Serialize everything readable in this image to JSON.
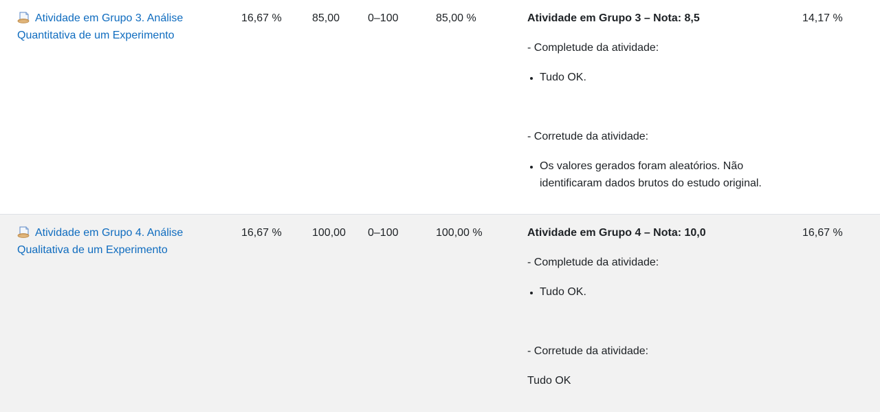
{
  "rows": [
    {
      "item_icon": "assignment-icon",
      "item_name": "Atividade em Grupo 3. Análise Quantitativa de um Experimento",
      "weight": "16,67 %",
      "grade": "85,00",
      "range": "0–100",
      "percentage": "85,00 %",
      "feedback": {
        "title": "Atividade em Grupo 3 – Nota: 8,5",
        "completeness_label": "- Completude da atividade:",
        "completeness_items": [
          "Tudo OK."
        ],
        "correctness_label": "- Corretude da atividade:",
        "correctness_items": [
          "Os valores gerados foram aleatórios. Não identificaram dados brutos do estudo original."
        ]
      },
      "contribution": "14,17 %"
    },
    {
      "item_icon": "assignment-icon",
      "item_name": "Atividade em Grupo 4. Análise Qualitativa de um Experimento",
      "weight": "16,67 %",
      "grade": "100,00",
      "range": "0–100",
      "percentage": "100,00 %",
      "feedback": {
        "title": "Atividade em Grupo 4 – Nota: 10,0",
        "completeness_label": "- Completude da atividade:",
        "completeness_items": [
          "Tudo OK."
        ],
        "correctness_label": "- Corretude da atividade:",
        "correctness_text": "Tudo OK"
      },
      "contribution": "16,67 %"
    }
  ],
  "colors": {
    "link": "#0f6cbf",
    "text": "#1d2125",
    "alt_row_bg": "#f2f2f2"
  }
}
